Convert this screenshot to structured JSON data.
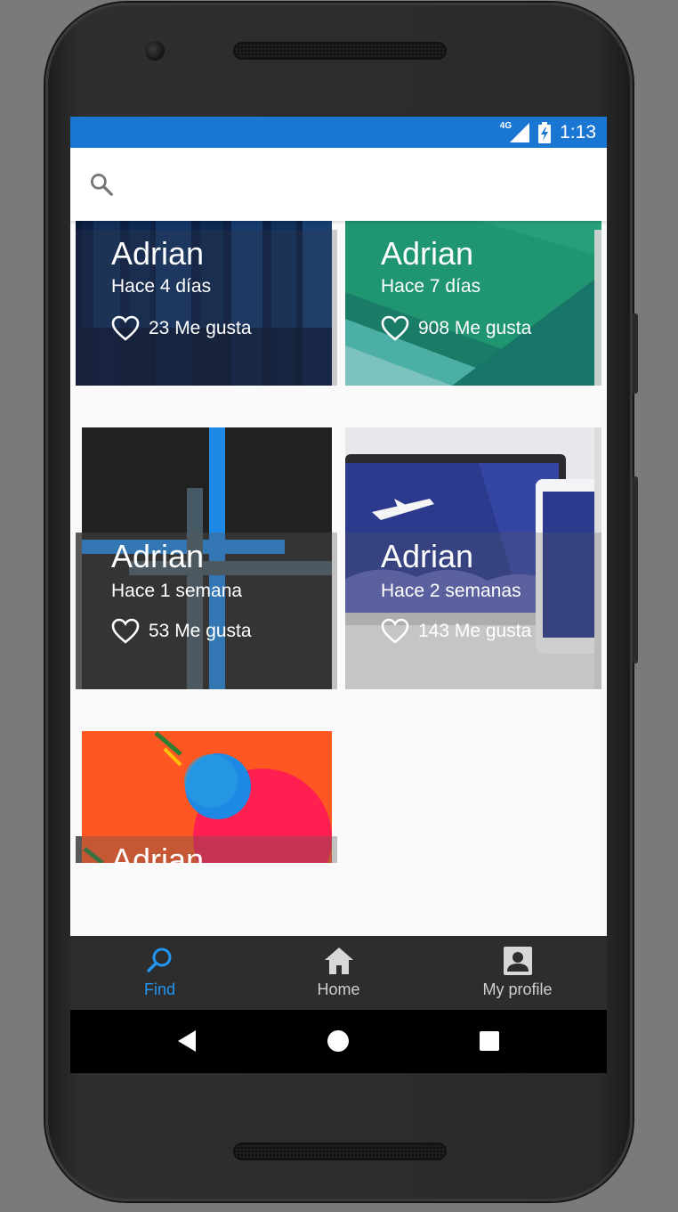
{
  "status_bar": {
    "network": "4G",
    "time": "1:13",
    "background_color": "#1976d2"
  },
  "search": {
    "icon": "search-icon",
    "value": "",
    "placeholder": ""
  },
  "feed": {
    "cards": [
      {
        "author": "Adrian",
        "time_ago": "Hace 4 días",
        "likes": "23 Me gusta"
      },
      {
        "author": "Adrian",
        "time_ago": "Hace 7 días",
        "likes": "908 Me gusta"
      },
      {
        "author": "Adrian",
        "time_ago": "Hace 1 semana",
        "likes": "53 Me gusta"
      },
      {
        "author": "Adrian",
        "time_ago": "Hace 2 semanas",
        "likes": "143 Me gusta"
      },
      {
        "author": "Adrian"
      }
    ]
  },
  "bottom_nav": {
    "items": [
      {
        "label": "Find",
        "icon": "search-icon",
        "active": true
      },
      {
        "label": "Home",
        "icon": "home-icon",
        "active": false
      },
      {
        "label": "My profile",
        "icon": "account-box-icon",
        "active": false
      }
    ],
    "active_color": "#2196f3"
  },
  "system_nav": {
    "items": [
      "back-icon",
      "home-circle-icon",
      "recents-icon"
    ]
  }
}
